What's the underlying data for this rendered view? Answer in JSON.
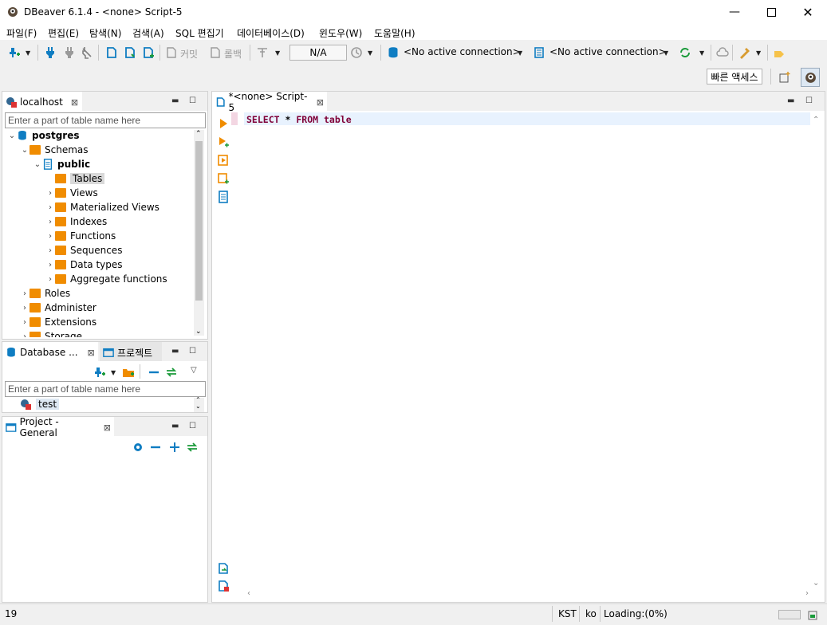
{
  "window": {
    "title": "DBeaver 6.1.4 - <none> Script-5",
    "minimize_icon": "minimize-icon",
    "maximize_icon": "maximize-icon",
    "close_icon": "close-icon"
  },
  "menu": {
    "items": [
      "파일(F)",
      "편집(E)",
      "탐색(N)",
      "검색(A)",
      "SQL 편집기",
      "데이터베이스(D)",
      "윈도우(W)",
      "도움말(H)"
    ]
  },
  "toolbar": {
    "commit_label": "커밋",
    "rollback_label": "롤백",
    "transaction_mode": "N/A",
    "connection_selector": "<No active connection>",
    "schema_selector": "<No active connection>",
    "quick_access_label": "빠른 액세스"
  },
  "navigator": {
    "tab_label": "localhost",
    "filter_placeholder": "Enter a part of table name here",
    "tree": {
      "root": "postgres",
      "schemas": "Schemas",
      "public": "public",
      "children": [
        "Tables",
        "Views",
        "Materialized Views",
        "Indexes",
        "Functions",
        "Sequences",
        "Data types",
        "Aggregate functions"
      ],
      "others": [
        "Roles",
        "Administer",
        "Extensions",
        "Storage"
      ]
    }
  },
  "database_panel": {
    "tab_label": "Database ...",
    "projects_tab_label": "프로젝트",
    "filter_placeholder": "Enter a part of table name here",
    "connection": "test"
  },
  "project_panel": {
    "tab_label": "Project - General"
  },
  "editor": {
    "tab_label": "*<none> Script-5",
    "code": {
      "kw1": "SELECT",
      "star": "*",
      "kw2": "FROM",
      "ident": "table"
    }
  },
  "status": {
    "line": "19",
    "timezone": "KST",
    "locale": "ko",
    "loading": "Loading:(0%)"
  },
  "colors": {
    "accent": "#0f7dc2",
    "folder": "#f08c00",
    "keyword": "#7f0038",
    "green": "#1a9a3a"
  }
}
